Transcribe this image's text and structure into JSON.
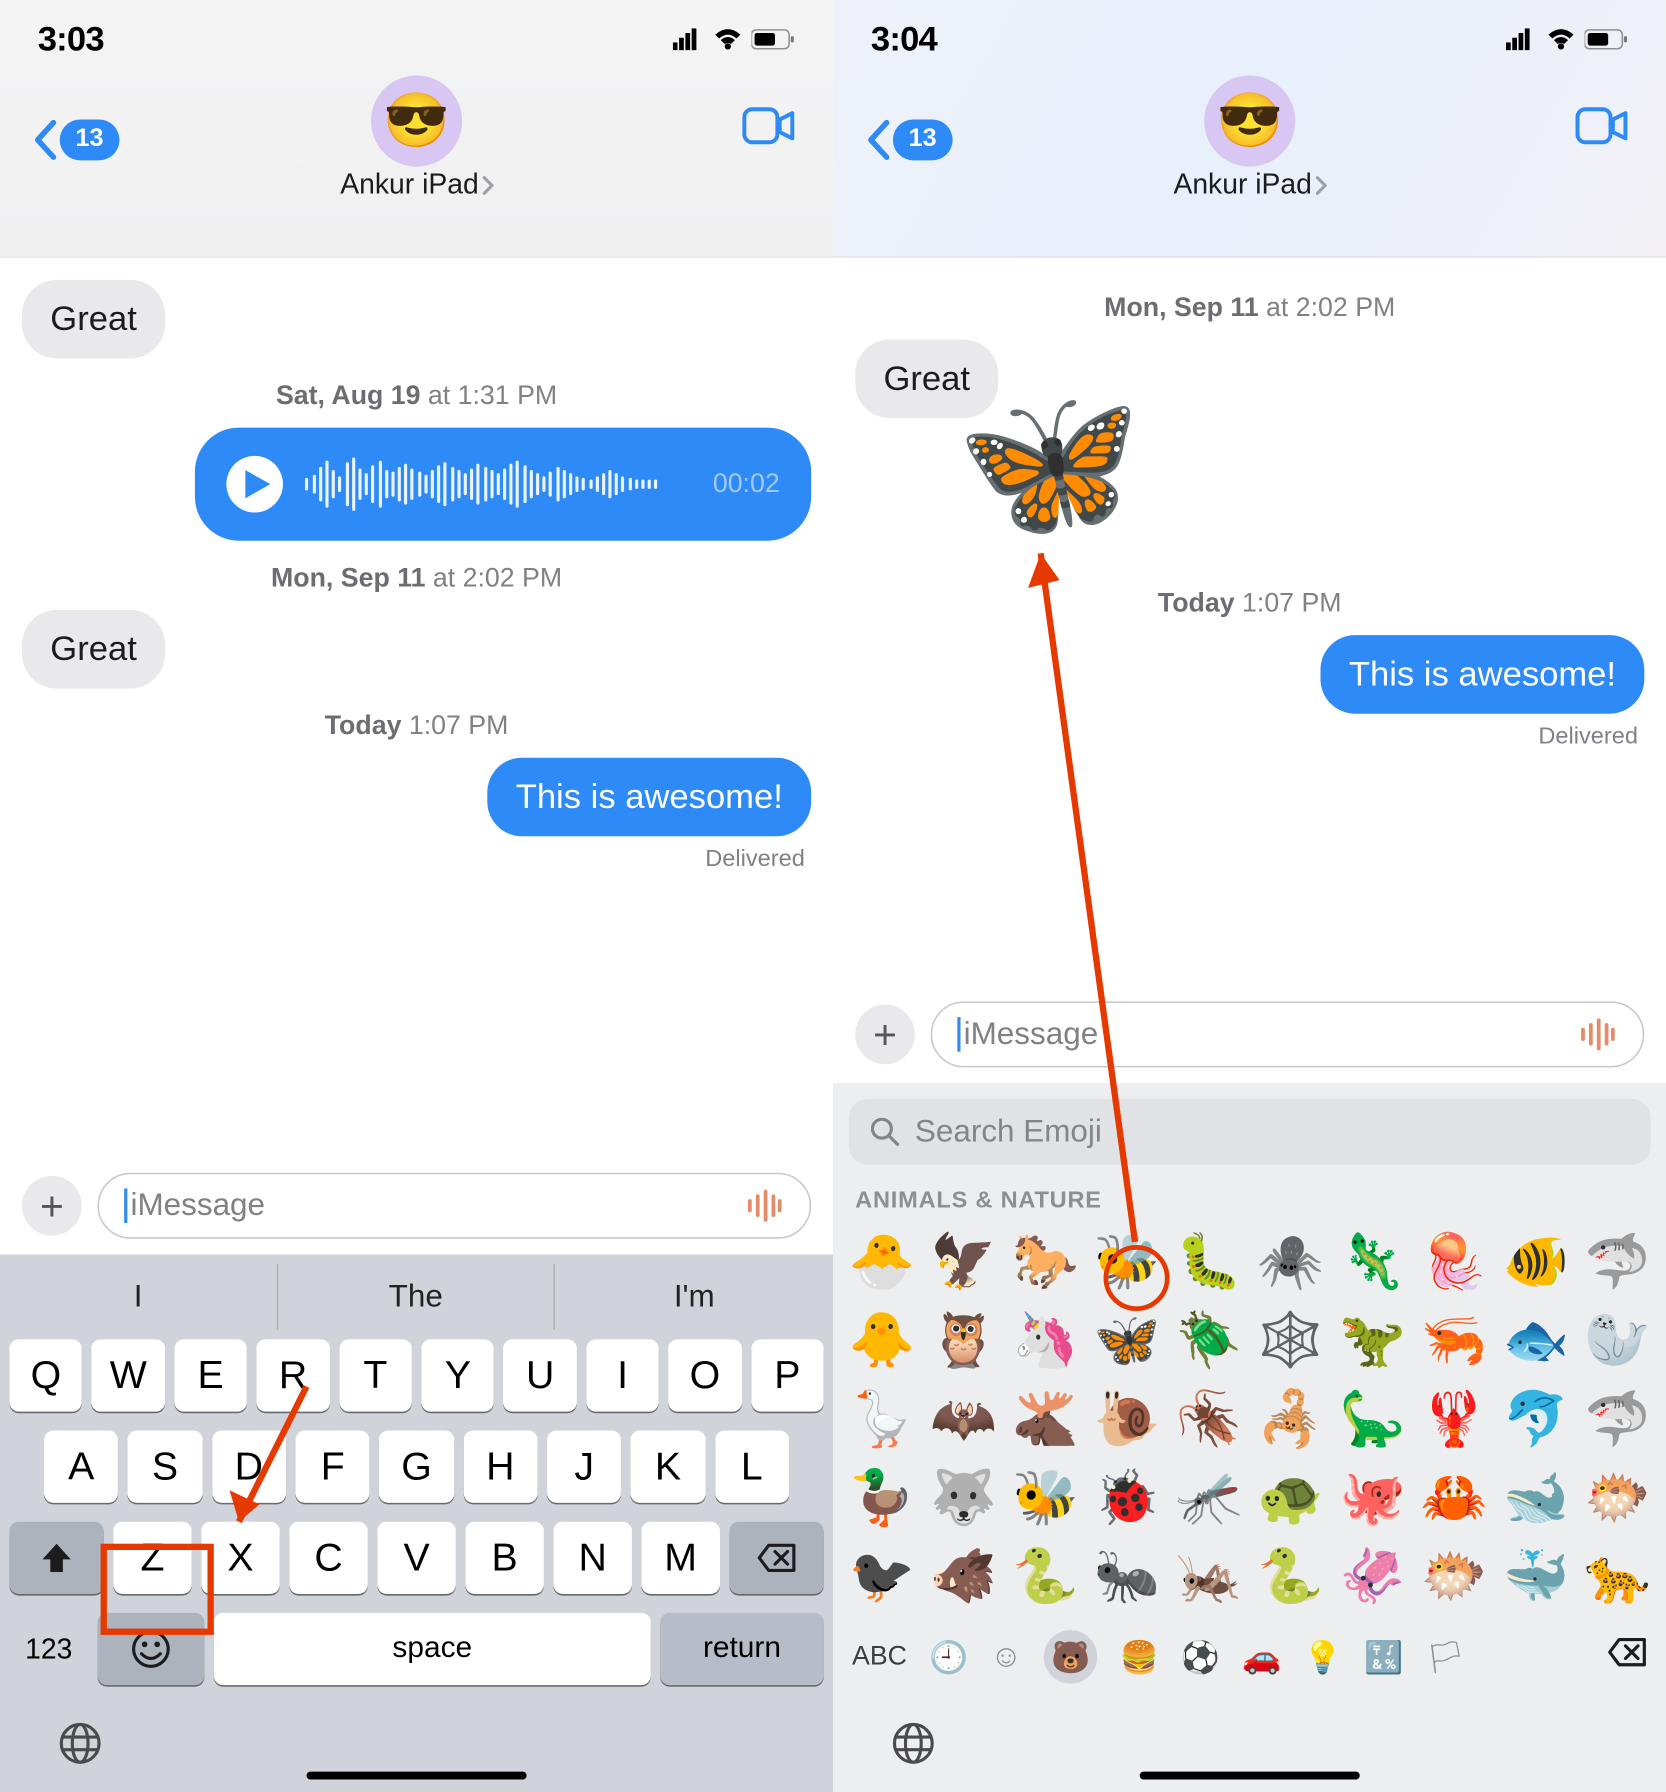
{
  "left": {
    "status": {
      "time": "3:03"
    },
    "header": {
      "back_badge": "13",
      "avatar_emoji": "😎",
      "contact": "Ankur iPad"
    },
    "thread": {
      "msg_great1": "Great",
      "ts1": "Sat, Aug 19 at 1:31 PM",
      "ts1_bold": "Sat, Aug 19",
      "ts1_rest": " at 1:31 PM",
      "audio_duration": "00:02",
      "ts2": "Mon, Sep 11 at 2:02 PM",
      "ts2_bold": "Mon, Sep 11",
      "ts2_rest": " at 2:02 PM",
      "msg_great2": "Great",
      "ts3": "Today 1:07 PM",
      "ts3_bold": "Today",
      "ts3_rest": " 1:07 PM",
      "msg_awesome": "This is awesome!",
      "delivered": "Delivered"
    },
    "compose": {
      "placeholder": "iMessage"
    },
    "suggestions": [
      "I",
      "The",
      "I'm"
    ],
    "keyboard": {
      "row1": [
        "Q",
        "W",
        "E",
        "R",
        "T",
        "Y",
        "U",
        "I",
        "O",
        "P"
      ],
      "row2": [
        "A",
        "S",
        "D",
        "F",
        "G",
        "H",
        "J",
        "K",
        "L"
      ],
      "row3": [
        "Z",
        "X",
        "C",
        "V",
        "B",
        "N",
        "M"
      ],
      "k123": "123",
      "emoji": "😀",
      "space": "space",
      "return": "return"
    }
  },
  "right": {
    "status": {
      "time": "3:04"
    },
    "header": {
      "back_badge": "13",
      "avatar_emoji": "😎",
      "contact": "Ankur iPad"
    },
    "thread": {
      "ts1": "Mon, Sep 11 at 2:02 PM",
      "ts1_bold": "Mon, Sep 11",
      "ts1_rest": " at 2:02 PM",
      "msg_great": "Great",
      "ts2": "Today 1:07 PM",
      "ts2_bold": "Today",
      "ts2_rest": " 1:07 PM",
      "msg_awesome": "This is awesome!",
      "delivered": "Delivered"
    },
    "compose": {
      "placeholder": "iMessage"
    },
    "emoji_picker": {
      "search_placeholder": "Search Emoji",
      "category_header": "ANIMALS & NATURE",
      "grid": [
        "🐣",
        "🦅",
        "🐎",
        "🐝",
        "🐛",
        "🕷️",
        "🦎",
        "🪼",
        "🐠",
        "🦈",
        "🐥",
        "🦉",
        "🦄",
        "🦋",
        "🪲",
        "🕸️",
        "🦖",
        "🦐",
        "🐟",
        "🦭",
        "🪿",
        "🦇",
        "🫎",
        "🐌",
        "🪳",
        "🦂",
        "🦕",
        "🦞",
        "🐬",
        "🦈",
        "🦆",
        "🐺",
        "🐝",
        "🐞",
        "🦟",
        "🐢",
        "🐙",
        "🦀",
        "🐋",
        "🐡",
        "🐦‍⬛",
        "🐗",
        "🐍",
        "🐜",
        "🦗",
        "🐍",
        "🦑",
        "🐡",
        "🐳",
        "🐆"
      ],
      "categories": {
        "abc": "ABC",
        "recent": "🕘",
        "smiley": "☺",
        "animals": "🐻",
        "food": "🍔",
        "activity": "⚽",
        "travel": "🚗",
        "objects": "💡",
        "symbols": "🔣",
        "flags": "🏳️",
        "del": "⌫"
      }
    }
  }
}
